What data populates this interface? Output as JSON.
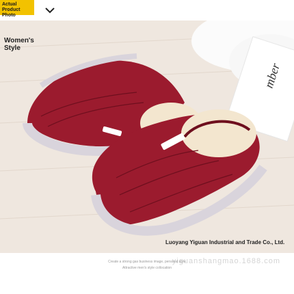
{
  "badge": {
    "line1": "Actual Product",
    "line2": "Photo"
  },
  "label": "Women's\nStyle",
  "company": "Luoyang Yiguan Industrial and Trade Co., Ltd.",
  "card_text": "mber",
  "footer": {
    "line1": "Create a strong gas business image, personal style",
    "line2": "Attractive men's style collocation"
  },
  "watermark": "yiguanshangmao.1688.com",
  "colors": {
    "shoe": "#9b1b2e",
    "shoe_dark": "#6e0f1e",
    "fleece": "#f3e6cf",
    "sole": "#d9d4dc",
    "badge": "#f2c200"
  }
}
